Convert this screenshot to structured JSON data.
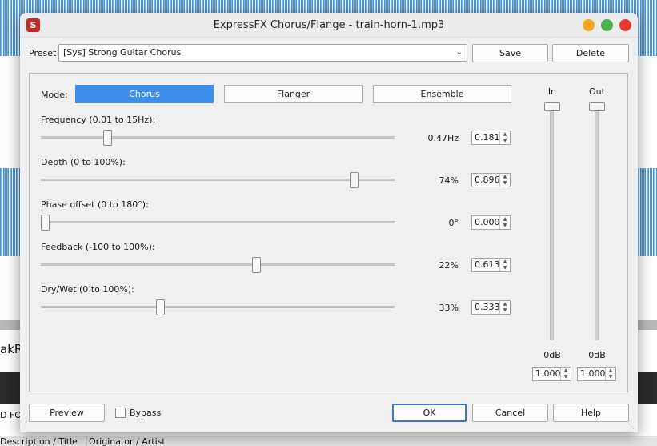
{
  "background": {
    "text_left_1": "akR",
    "text_left_2": "D FO",
    "columns": [
      "Description / Title",
      "Originator / Artist"
    ]
  },
  "dialog": {
    "title": "ExpressFX Chorus/Flange - train-horn-1.mp3",
    "app_icon": "S",
    "window_buttons": {
      "minimize_color": "#f5a623",
      "maximize_color": "#4caf50",
      "close_color": "#e53935"
    }
  },
  "preset": {
    "label": "Preset",
    "value": "[Sys] Strong Guitar Chorus",
    "save_label": "Save",
    "delete_label": "Delete"
  },
  "mode": {
    "label": "Mode:",
    "options": [
      "Chorus",
      "Flanger",
      "Ensemble"
    ],
    "selected": "Chorus",
    "accent_color": "#3d8eea"
  },
  "sliders": [
    {
      "label": "Frequency (0.01 to 15Hz):",
      "display": "0.47Hz",
      "value": "0.181",
      "level": 0.181
    },
    {
      "label": "Depth (0 to 100%):",
      "display": "74%",
      "value": "0.896",
      "level": 0.896
    },
    {
      "label": "Phase offset (0 to 180°):",
      "display": "0°",
      "value": "0.000",
      "level": 0.0
    },
    {
      "label": "Feedback (-100 to 100%):",
      "display": "22%",
      "value": "0.613",
      "level": 0.613
    },
    {
      "label": "Dry/Wet (0 to 100%):",
      "display": "33%",
      "value": "0.333",
      "level": 0.333
    }
  ],
  "meters": {
    "in": {
      "label": "In",
      "db": "0dB",
      "value": "1.000"
    },
    "out": {
      "label": "Out",
      "db": "0dB",
      "value": "1.000"
    }
  },
  "footer": {
    "preview_label": "Preview",
    "bypass_label": "Bypass",
    "ok_label": "OK",
    "cancel_label": "Cancel",
    "help_label": "Help"
  }
}
